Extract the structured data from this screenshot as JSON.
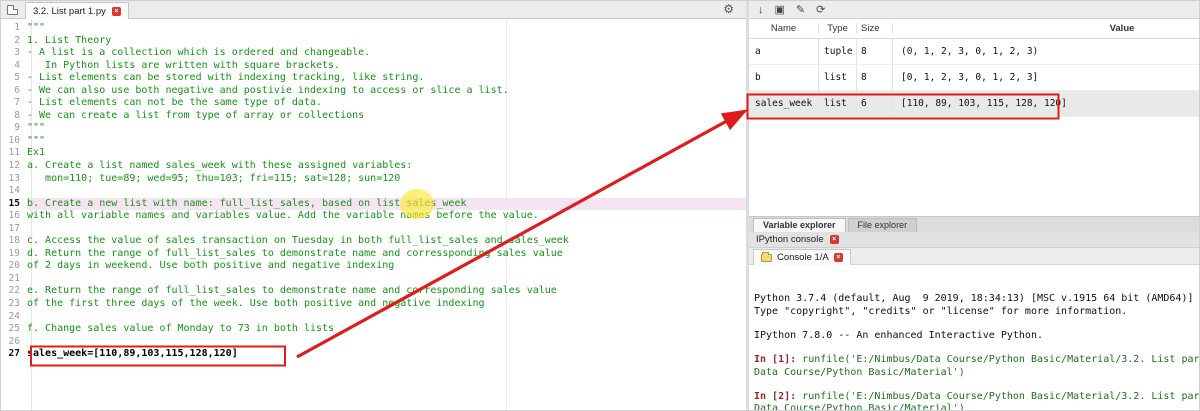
{
  "editor": {
    "tab": {
      "label": "3.2. List part 1.py",
      "close_glyph": "×"
    },
    "gear_glyph": "⚙",
    "lines": [
      {
        "n": "1",
        "t": "\"\"\"",
        "cls": "c"
      },
      {
        "n": "2",
        "t": "1. List Theory",
        "cls": "c"
      },
      {
        "n": "3",
        "t": "- A list is a collection which is ordered and changeable.",
        "cls": "c"
      },
      {
        "n": "4",
        "t": "   In Python lists are written with square brackets.",
        "cls": "c"
      },
      {
        "n": "5",
        "t": "- List elements can be stored with indexing tracking, like string.",
        "cls": "c"
      },
      {
        "n": "6",
        "t": "- We can also use both negative and postivie indexing to access or slice a list.",
        "cls": "c"
      },
      {
        "n": "7",
        "t": "- List elements can not be the same type of data.",
        "cls": "c"
      },
      {
        "n": "8",
        "t": "- We can create a list from type of array or collections",
        "cls": "c"
      },
      {
        "n": "9",
        "t": "\"\"\"",
        "cls": "c"
      },
      {
        "n": "10",
        "t": "\"\"\"",
        "cls": "c"
      },
      {
        "n": "11",
        "t": "Ex1",
        "cls": "c"
      },
      {
        "n": "12",
        "t": "a. Create a list named sales_week with these assigned variables:",
        "cls": "c"
      },
      {
        "n": "13",
        "t": "   mon=110; tue=89; wed=95; thu=103; fri=115; sat=128; sun=120",
        "cls": "c"
      },
      {
        "n": "14",
        "t": "",
        "cls": "c"
      },
      {
        "n": "15",
        "t": "b. Create a new list with name: full_list_sales, based on list sales_week",
        "cls": "c",
        "cur": true
      },
      {
        "n": "16",
        "t": "with all variable names and variables value. Add the variable names before the value.",
        "cls": "c"
      },
      {
        "n": "17",
        "t": "",
        "cls": "c"
      },
      {
        "n": "18",
        "t": "c. Access the value of sales transaction on Tuesday in both full_list_sales and sales_week",
        "cls": "c"
      },
      {
        "n": "19",
        "t": "d. Return the range of full_list_sales to demonstrate name and corressponding sales value",
        "cls": "c"
      },
      {
        "n": "20",
        "t": "of 2 days in weekend. Use both positive and negative indexing",
        "cls": "c"
      },
      {
        "n": "21",
        "t": "",
        "cls": "c"
      },
      {
        "n": "22",
        "t": "e. Return the range of full_list_sales to demonstrate name and corresponding sales value",
        "cls": "c"
      },
      {
        "n": "23",
        "t": "of the first three days of the week. Use both positive and negative indexing",
        "cls": "c"
      },
      {
        "n": "24",
        "t": "",
        "cls": "c"
      },
      {
        "n": "25",
        "t": "f. Change sales value of Monday to 73 in both lists",
        "cls": "c"
      },
      {
        "n": "26",
        "t": "",
        "cls": "c"
      },
      {
        "n": "27",
        "t": "sales_week=[110,89,103,115,128,120]",
        "cls": "k",
        "nb": true
      }
    ]
  },
  "variable_explorer": {
    "toolbar_icons": [
      {
        "name": "import-data-icon",
        "glyph": "↓"
      },
      {
        "name": "save-data-icon",
        "glyph": "▣"
      },
      {
        "name": "edit-data-icon",
        "glyph": "✎"
      },
      {
        "name": "refresh-icon",
        "glyph": "⟳"
      }
    ],
    "headers": [
      "Name",
      "Type",
      "Size",
      "Value"
    ],
    "rows": [
      {
        "name": "a",
        "type": "tuple",
        "size": "8",
        "value": "(0, 1, 2, 3, 0, 1, 2, 3)",
        "selected": false
      },
      {
        "name": "b",
        "type": "list",
        "size": "8",
        "value": "[0, 1, 2, 3, 0, 1, 2, 3]",
        "selected": false
      },
      {
        "name": "sales_week",
        "type": "list",
        "size": "6",
        "value": "[110, 89, 103, 115, 128, 120]",
        "selected": true
      }
    ],
    "tabs": [
      {
        "label": "Variable explorer",
        "active": true
      },
      {
        "label": "File explorer",
        "active": false
      }
    ]
  },
  "console": {
    "pane_title": "IPython console",
    "close_glyph": "×",
    "tab_label": "Console 1/A",
    "lines": [
      [
        {
          "t": "Python 3.7.4 (default, Aug  9 2019, 18:34:13) [MSC v.1915 64 bit (AMD64)]",
          "c": "plain"
        }
      ],
      [
        {
          "t": "Type \"copyright\", \"credits\" or \"license\" for more information.",
          "c": "plain"
        }
      ],
      [],
      [
        {
          "t": "IPython 7.8.0 -- An enhanced Interactive Python.",
          "c": "plain"
        }
      ],
      [],
      [
        {
          "t": "In [1]: ",
          "c": "prompt"
        },
        {
          "t": "runfile('E:/Nimbus/Data Course/Python Basic/Material/3.2. List par",
          "c": "code"
        }
      ],
      [
        {
          "t": "Data Course/Python Basic/Material')",
          "c": "code"
        }
      ],
      [],
      [
        {
          "t": "In [2]: ",
          "c": "prompt"
        },
        {
          "t": "runfile('E:/Nimbus/Data Course/Python Basic/Material/3.2. List par",
          "c": "code"
        }
      ],
      [
        {
          "t": "Data Course/Python Basic/Material')",
          "c": "code"
        }
      ]
    ]
  },
  "annotations": {
    "highlight_color": "#e01b1b",
    "click_circle_color": "#ffe733"
  }
}
